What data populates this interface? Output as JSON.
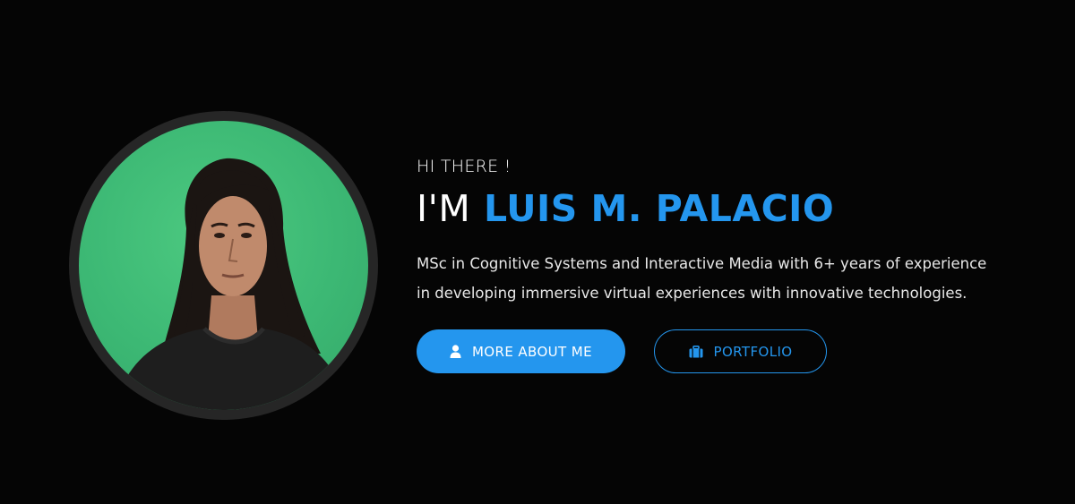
{
  "hero": {
    "greeting": "HI THERE !",
    "headline_prefix": "I'M",
    "name": "LUIS M. PALACIO",
    "description": "MSc in Cognitive Systems and Interactive Media with 6+ years of experience in developing immersive virtual experiences with innovative technologies."
  },
  "buttons": {
    "about_label": "MORE ABOUT ME",
    "about_icon": "user-icon",
    "portfolio_label": "PORTFOLIO",
    "portfolio_icon": "briefcase-icon"
  },
  "colors": {
    "background": "#050505",
    "accent": "#2496ee",
    "avatar_ring": "#262626",
    "avatar_bg": "#3cb874"
  }
}
